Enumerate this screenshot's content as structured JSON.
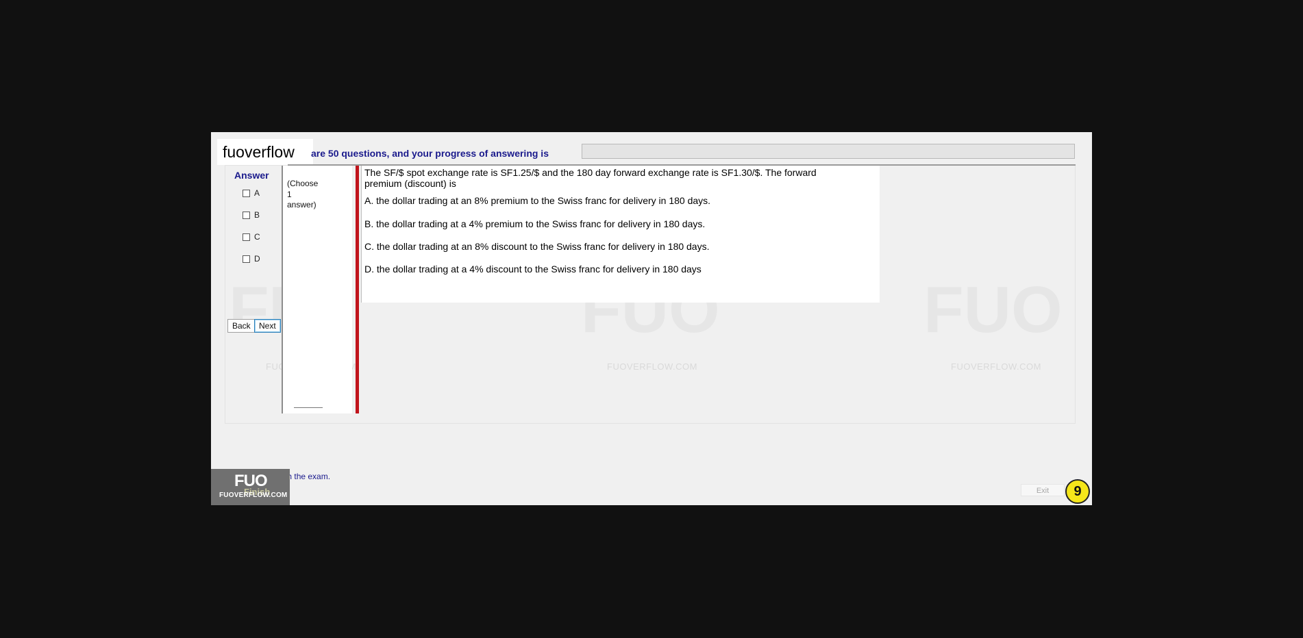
{
  "brand": {
    "name": "fuoverflow"
  },
  "header": {
    "progress_text": "are 50 questions, and your progress of answering is",
    "progress_fraction": 0
  },
  "answer_panel": {
    "title": "Answer",
    "options": [
      "A",
      "B",
      "C",
      "D"
    ],
    "back_label": "Back",
    "next_label": "Next"
  },
  "choose_panel": {
    "line1": "(Choose",
    "line2": "1",
    "line3": "answer)"
  },
  "question": {
    "stem": "The SF/$ spot exchange rate is SF1.25/$ and the 180 day forward exchange rate is SF1.30/$. The forward premium (discount) is",
    "options": [
      "A.  the dollar trading at an 8% premium to the Swiss franc for delivery in 180 days.",
      "B.  the dollar trading at a 4% premium to the Swiss franc for delivery in 180 days.",
      "C.  the dollar trading at an 8% discount to the Swiss franc for delivery in 180 days.",
      "D.  the dollar trading at a 4% discount to the Swiss franc for delivery in 180 days"
    ]
  },
  "footer": {
    "finish_text": "want to finish the exam.",
    "finish_button": "Finish",
    "logo_main": "FUO",
    "logo_sub": "FUOVERFLOW.COM",
    "exit_label": "Exit",
    "page_number": "9"
  },
  "watermark": {
    "text": "FUOVERFLOW.COM"
  }
}
